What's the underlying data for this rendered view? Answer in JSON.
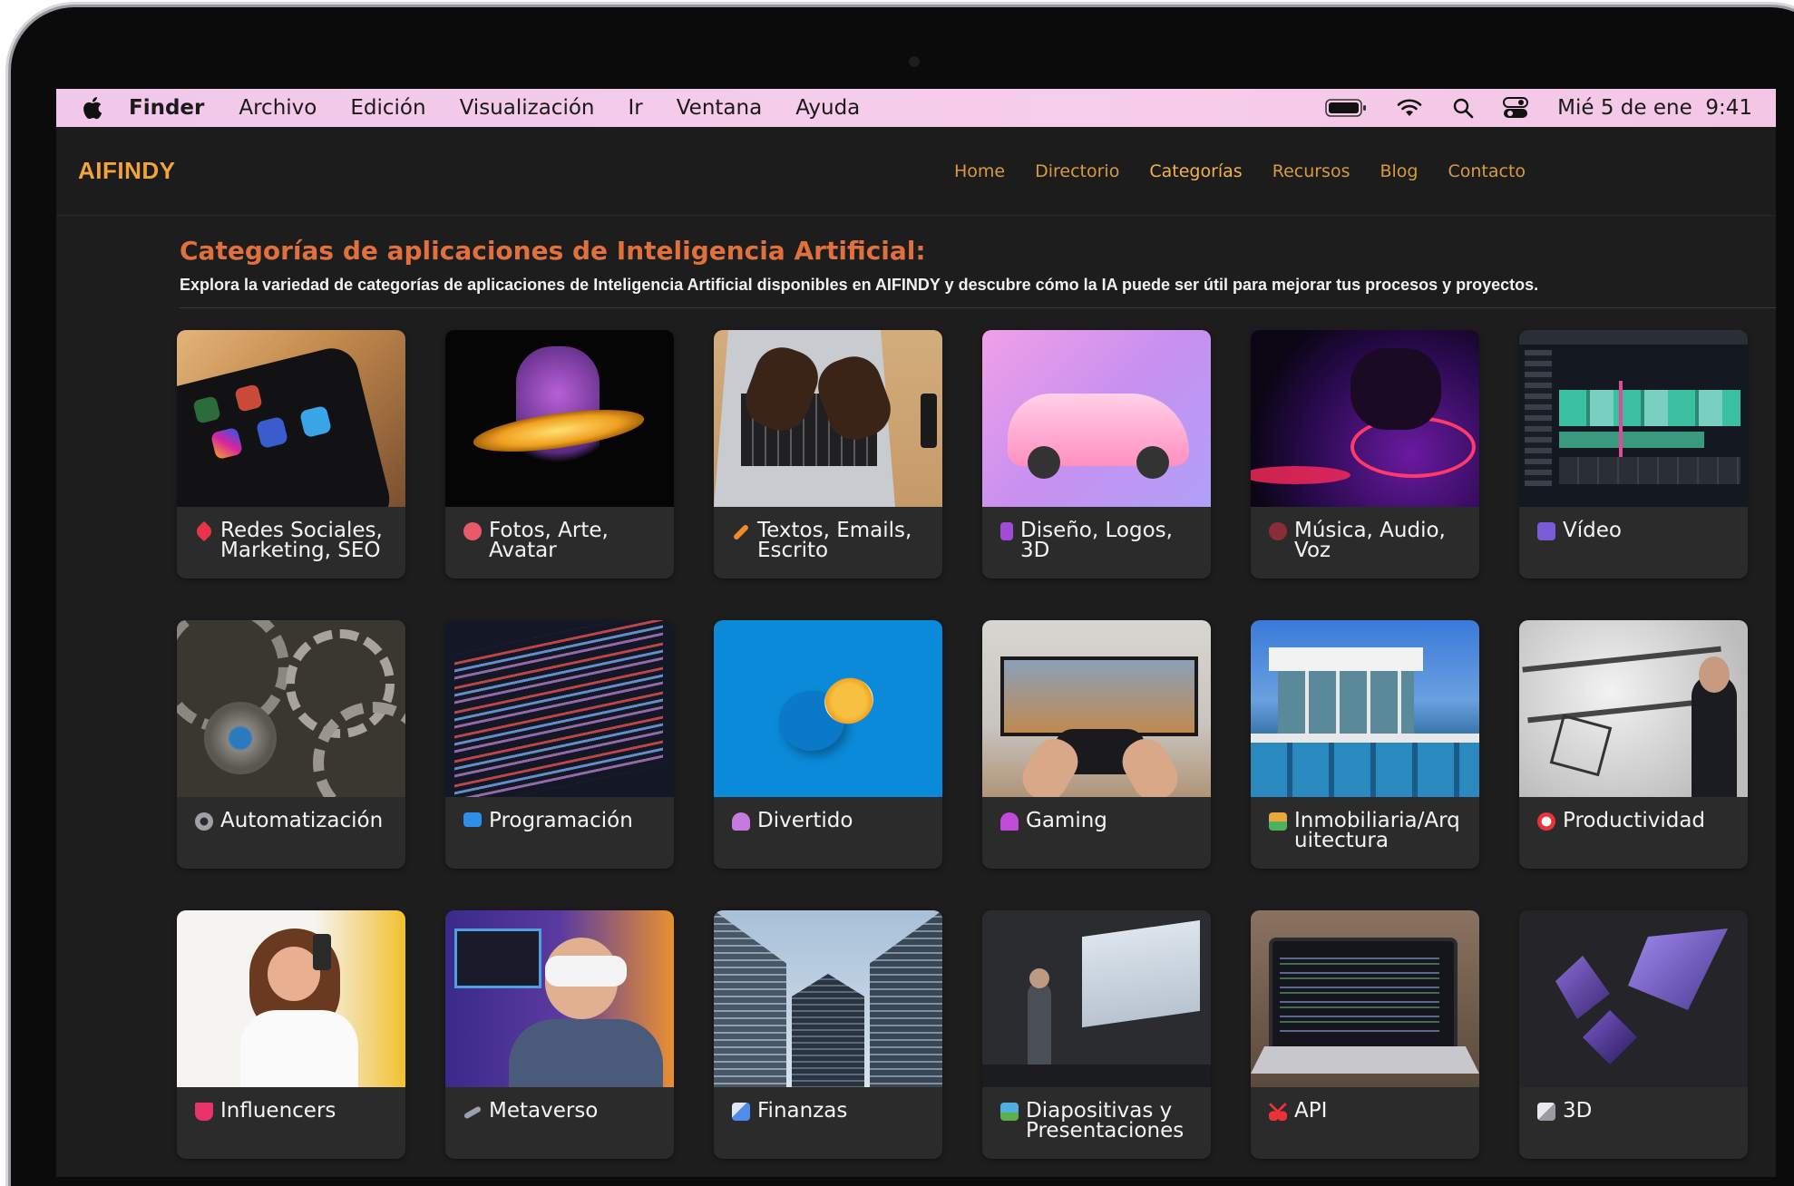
{
  "menubar": {
    "app": "Finder",
    "items": [
      "Archivo",
      "Edición",
      "Visualización",
      "Ir",
      "Ventana",
      "Ayuda"
    ],
    "datetime": "Mié 5 de ene  9:41"
  },
  "site": {
    "logo": "AIFINDY",
    "nav": [
      "Home",
      "Directorio",
      "Categorías",
      "Recursos",
      "Blog",
      "Contacto"
    ],
    "active_nav": "Categorías",
    "colors": {
      "accent": "#f0a43a",
      "heading": "#e0703e",
      "background": "#1e1d1e",
      "card": "#2c2b2c"
    }
  },
  "page": {
    "heading": "Categorías de aplicaciones de Inteligencia Artificial:",
    "subheading": "Explora la variedad de categorías de aplicaciones de Inteligencia Artificial disponibles en AIFINDY y descubre cómo la IA puede ser útil para mejorar tus procesos y proyectos."
  },
  "categories": [
    {
      "label": "Redes Sociales, Marketing, SEO",
      "icon": "rocket-icon",
      "icon_color": "#e8334a",
      "photo": "phone-social-apps"
    },
    {
      "label": "Fotos, Arte, Avatar",
      "icon": "palette-icon",
      "icon_color": "#e85a6a",
      "photo": "neon-hand-ring"
    },
    {
      "label": "Textos, Emails, Escrito",
      "icon": "pencil-icon",
      "icon_color": "#f08a2a",
      "photo": "hands-laptop-typing"
    },
    {
      "label": "Diseño, Logos, 3D",
      "icon": "bookmark-icon",
      "icon_color": "#a34bd6",
      "photo": "pink-sports-car"
    },
    {
      "label": "Música, Audio, Voz",
      "icon": "music-icon",
      "icon_color": "#b02f3a",
      "photo": "dj-controller"
    },
    {
      "label": "Vídeo",
      "icon": "clapper-icon",
      "icon_color": "#7a5bd8",
      "photo": "video-editor-screen"
    },
    {
      "label": "Automatización",
      "icon": "gear-icon",
      "icon_color": "#a0a0a8",
      "photo": "watch-gears"
    },
    {
      "label": "Programación",
      "icon": "computer-icon",
      "icon_color": "#2f8ee8",
      "photo": "code-screen"
    },
    {
      "label": "Divertido",
      "icon": "people-icon",
      "icon_color": "#c47adf",
      "photo": "orange-on-blue"
    },
    {
      "label": "Gaming",
      "icon": "joystick-icon",
      "icon_color": "#c04bd6",
      "photo": "game-controller-desk"
    },
    {
      "label": "Inmobiliaria/Arquitectura",
      "icon": "house-icon",
      "icon_color": "#e8a83a",
      "photo": "modern-house-pool"
    },
    {
      "label": "Productividad",
      "icon": "alarm-clock-icon",
      "icon_color": "#e8333a",
      "photo": "productivity-board"
    },
    {
      "label": "Influencers",
      "icon": "cup-icon",
      "icon_color": "#e8336a",
      "photo": "woman-selfie"
    },
    {
      "label": "Metaverso",
      "icon": "telescope-icon",
      "icon_color": "#9aa0b0",
      "photo": "vr-headset-person"
    },
    {
      "label": "Finanzas",
      "icon": "chart-icon",
      "icon_color": "#4f8ee8",
      "photo": "skyscrapers"
    },
    {
      "label": "Diapositivas y Presentaciones",
      "icon": "picture-icon",
      "icon_color": "#4fb0e0",
      "photo": "presentation-room"
    },
    {
      "label": "API",
      "icon": "scissors-icon",
      "icon_color": "#e8333a",
      "photo": "laptop-code-dark"
    },
    {
      "label": "3D",
      "icon": "cube-icon",
      "icon_color": "#c9c9d0",
      "photo": "3d-shapes-purple"
    }
  ]
}
